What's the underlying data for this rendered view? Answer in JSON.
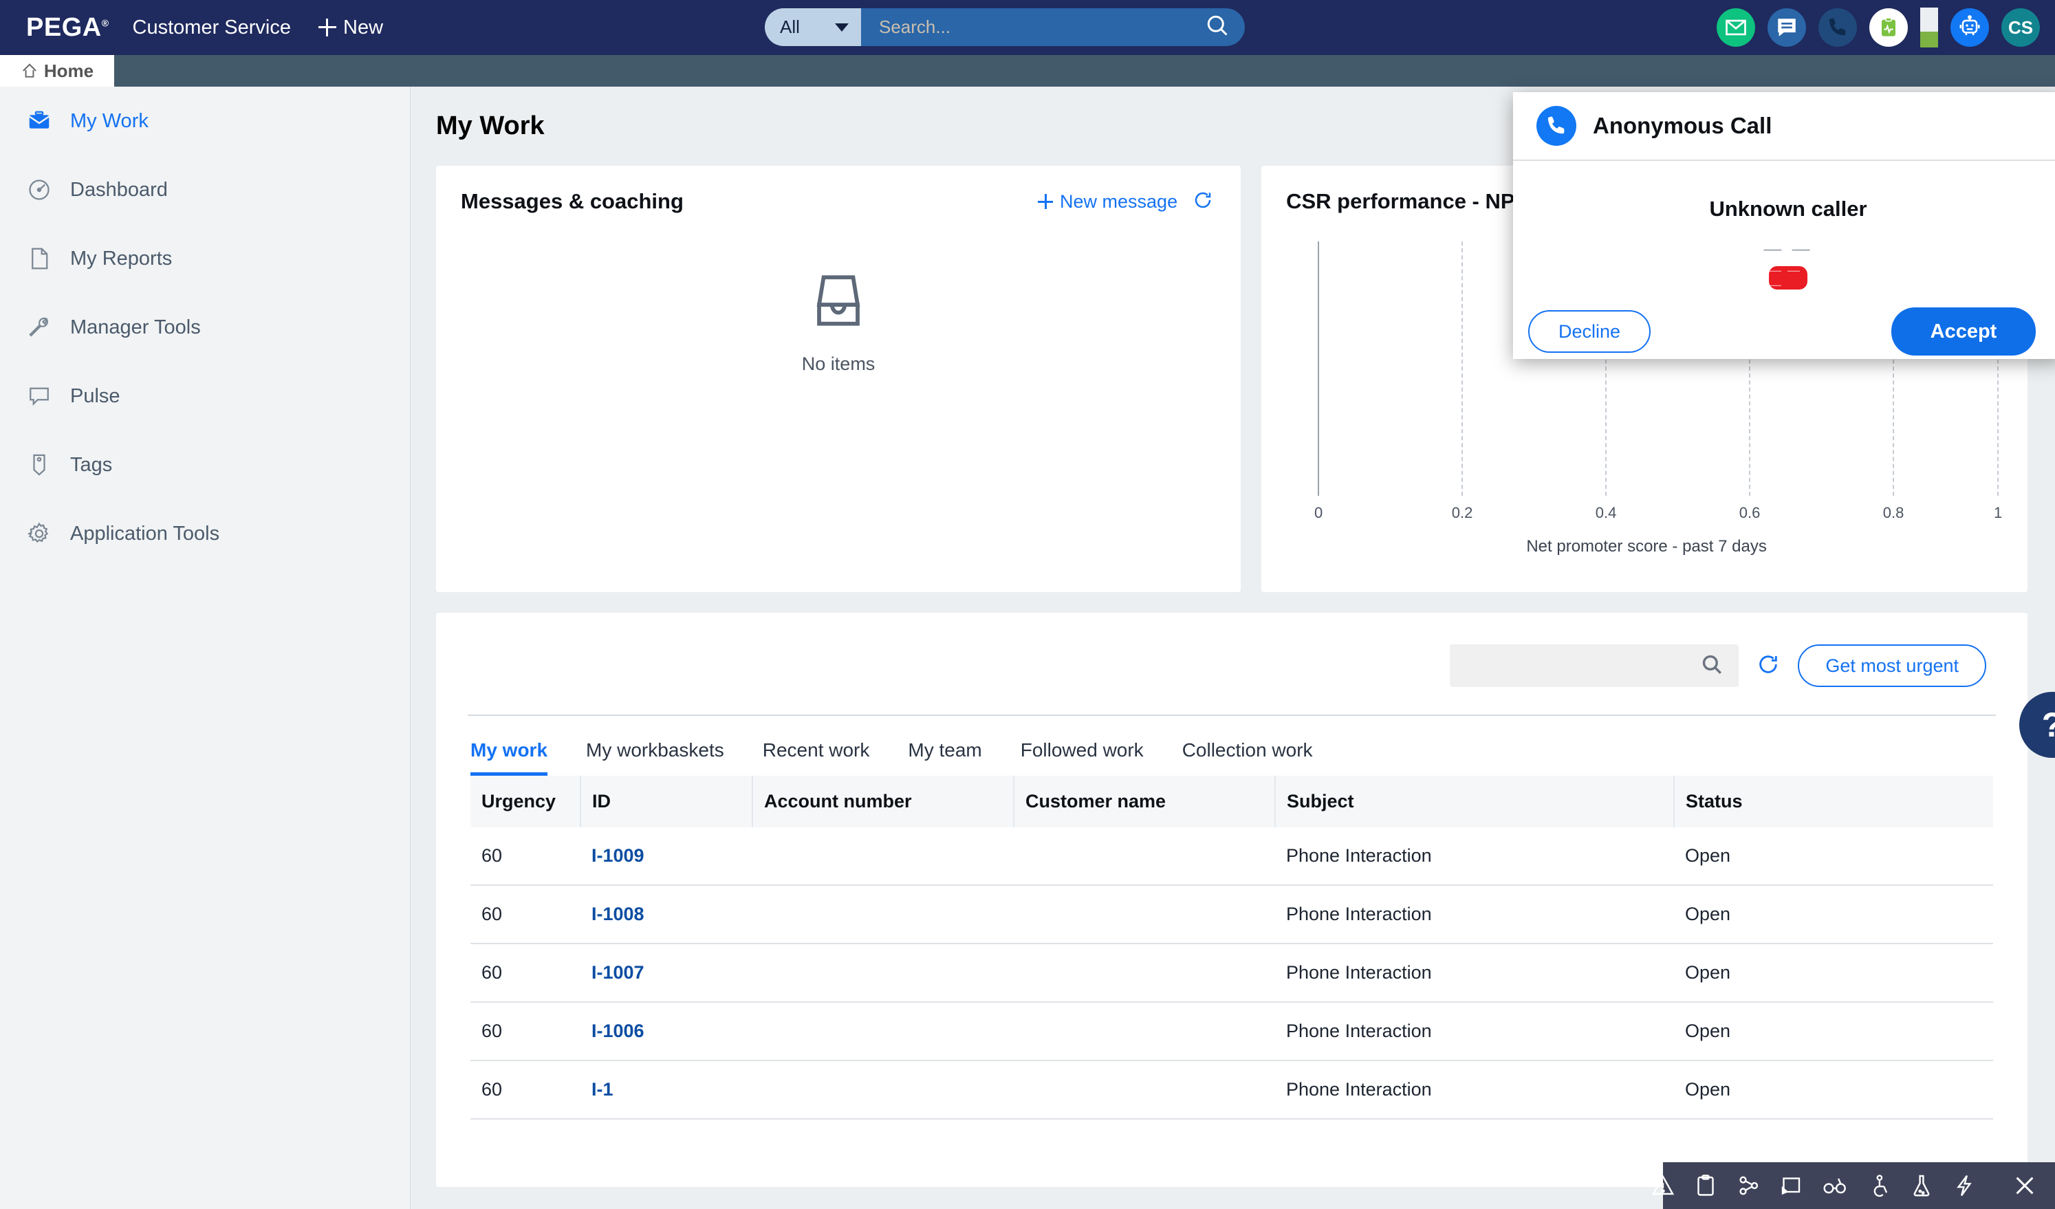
{
  "header": {
    "brand": "PEGA",
    "app_name": "Customer Service",
    "new_label": "New",
    "search": {
      "scope": "All",
      "placeholder": "Search...",
      "value": ""
    },
    "icons": [
      {
        "name": "mail-icon",
        "glyph": "envelope"
      },
      {
        "name": "chat-icon",
        "glyph": "speech-bubble"
      },
      {
        "name": "phone-icon",
        "glyph": "handset"
      },
      {
        "name": "clipboard-icon",
        "glyph": "clipboard-pulse"
      },
      {
        "name": "battery-icon",
        "glyph": "battery"
      },
      {
        "name": "bot-icon",
        "glyph": "robot"
      }
    ],
    "avatar_initials": "CS",
    "colors": {
      "topbar": "#1f2a5e",
      "mail": "#0ec27f",
      "chat": "#2a66a8",
      "phone": "#204a7c",
      "bot": "#1278f3",
      "avatar": "#12848f",
      "battery_fill": "#7cb342"
    }
  },
  "tabstrip": {
    "home_label": "Home"
  },
  "sidebar": {
    "items": [
      {
        "label": "My Work",
        "icon": "briefcase-icon",
        "active": true
      },
      {
        "label": "Dashboard",
        "icon": "gauge-icon",
        "active": false
      },
      {
        "label": "My Reports",
        "icon": "document-icon",
        "active": false
      },
      {
        "label": "Manager Tools",
        "icon": "wrench-icon",
        "active": false
      },
      {
        "label": "Pulse",
        "icon": "comment-icon",
        "active": false
      },
      {
        "label": "Tags",
        "icon": "tag-icon",
        "active": false
      },
      {
        "label": "Application Tools",
        "icon": "gear-icon",
        "active": false
      }
    ]
  },
  "main": {
    "page_title": "My Work",
    "messages_card": {
      "title": "Messages & coaching",
      "new_message_label": "New message",
      "refresh_icon": "refresh-icon",
      "empty_icon": "inbox-icon",
      "empty_label": "No items"
    },
    "nps_card": {
      "title": "CSR performance - NPS"
    },
    "worklist": {
      "search_placeholder": "",
      "search_value": "",
      "refresh_icon": "refresh-icon",
      "get_most_urgent_label": "Get most urgent",
      "help_label": "?",
      "tabs": [
        {
          "label": "My work",
          "active": true
        },
        {
          "label": "My workbaskets",
          "active": false
        },
        {
          "label": "Recent work",
          "active": false
        },
        {
          "label": "My team",
          "active": false
        },
        {
          "label": "Followed work",
          "active": false
        },
        {
          "label": "Collection work",
          "active": false
        }
      ],
      "columns": [
        "Urgency",
        "ID",
        "Account number",
        "Customer name",
        "Subject",
        "Status"
      ],
      "rows": [
        {
          "urgency": "60",
          "id": "I-1009",
          "account": "",
          "customer": "",
          "subject": "Phone Interaction",
          "status": "Open"
        },
        {
          "urgency": "60",
          "id": "I-1008",
          "account": "",
          "customer": "",
          "subject": "Phone Interaction",
          "status": "Open"
        },
        {
          "urgency": "60",
          "id": "I-1007",
          "account": "",
          "customer": "",
          "subject": "Phone Interaction",
          "status": "Open"
        },
        {
          "urgency": "60",
          "id": "I-1006",
          "account": "",
          "customer": "",
          "subject": "Phone Interaction",
          "status": "Open"
        },
        {
          "urgency": "60",
          "id": "I-1",
          "account": "",
          "customer": "",
          "subject": "Phone Interaction",
          "status": "Open"
        }
      ]
    }
  },
  "call_popup": {
    "title": "Anonymous Call",
    "phone_icon": "phone-icon",
    "caller": "Unknown caller",
    "number_masked": "— —",
    "badge_masked": "— — —",
    "decline_label": "Decline",
    "accept_label": "Accept",
    "colors": {
      "accept": "#0f6fe8",
      "decline_border": "#1472f2",
      "badge": "#ea1c24"
    }
  },
  "bottom_bar": {
    "icons": [
      {
        "name": "warning-icon"
      },
      {
        "name": "clipboard-icon"
      },
      {
        "name": "share-nodes-icon"
      },
      {
        "name": "screen-pointer-icon"
      },
      {
        "name": "glasses-icon"
      },
      {
        "name": "accessibility-icon"
      },
      {
        "name": "flask-icon"
      },
      {
        "name": "lightning-icon"
      },
      {
        "name": "close-icon"
      }
    ]
  },
  "chart_data": {
    "type": "bar",
    "title": "CSR performance - NPS",
    "xlabel": "Net promoter score - past 7 days",
    "ylabel": "",
    "categories": [],
    "values": [],
    "xticks": [
      "0",
      "0.2",
      "0.4",
      "0.6",
      "0.8",
      "1"
    ],
    "xlim": [
      0,
      1
    ],
    "grid": true,
    "legend": "none",
    "note": "Plot area contains no rendered data series"
  }
}
